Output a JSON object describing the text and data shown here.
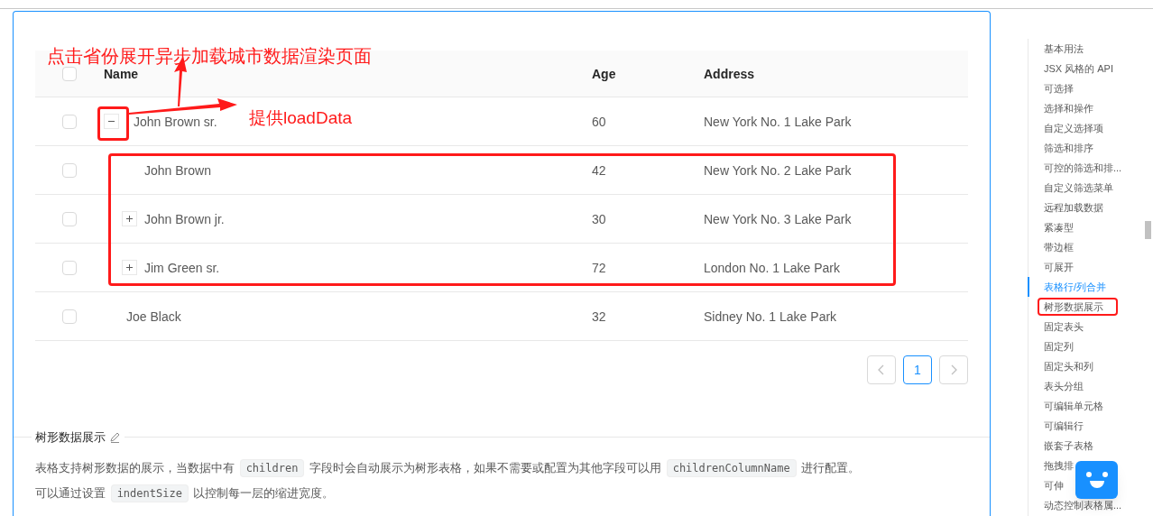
{
  "annotations": {
    "title_note": "点击省份展开异步加载城市数据渲染页面",
    "loaddata_note": "提供loadData"
  },
  "table": {
    "all_checked": false,
    "columns": [
      "Name",
      "Age",
      "Address"
    ],
    "rows": [
      {
        "name": "John Brown sr.",
        "age": "60",
        "address": "New York No. 1 Lake Park",
        "checked": false,
        "expanded": true,
        "children": [
          {
            "name": "John Brown",
            "age": "42",
            "address": "New York No. 2 Lake Park",
            "checked": false
          },
          {
            "name": "John Brown jr.",
            "age": "30",
            "address": "New York No. 3 Lake Park",
            "checked": false,
            "expanded": false
          },
          {
            "name": "Jim Green sr.",
            "age": "72",
            "address": "London No. 1 Lake Park",
            "checked": false,
            "expanded": false
          }
        ]
      },
      {
        "name": "Joe Black",
        "age": "32",
        "address": "Sidney No. 1 Lake Park",
        "checked": false
      }
    ]
  },
  "pagination": {
    "pages": [
      {
        "label": "1",
        "selected": true
      }
    ]
  },
  "section": {
    "title": "树形数据展示",
    "paragraphs": [
      [
        {
          "kind": "text",
          "text": "表格支持树形数据的展示，当数据中有 "
        },
        {
          "kind": "code",
          "text": "children"
        },
        {
          "kind": "text",
          "text": " 字段时会自动展示为树形表格，如果不需要或配置为其他字段可以用 "
        },
        {
          "kind": "code",
          "text": "childrenColumnName"
        },
        {
          "kind": "text",
          "text": " 进行配置。"
        }
      ],
      [
        {
          "kind": "text",
          "text": "可以通过设置 "
        },
        {
          "kind": "code",
          "text": "indentSize"
        },
        {
          "kind": "text",
          "text": " 以控制每一层的缩进宽度。"
        }
      ]
    ]
  },
  "nav": {
    "items": [
      {
        "label": "基本用法",
        "selected": false
      },
      {
        "label": "JSX 风格的 API",
        "selected": false
      },
      {
        "label": "可选择",
        "selected": false
      },
      {
        "label": "选择和操作",
        "selected": false
      },
      {
        "label": "自定义选择项",
        "selected": false
      },
      {
        "label": "筛选和排序",
        "selected": false
      },
      {
        "label": "可控的筛选和排...",
        "selected": false
      },
      {
        "label": "自定义筛选菜单",
        "selected": false
      },
      {
        "label": "远程加载数据",
        "selected": false
      },
      {
        "label": "紧凑型",
        "selected": false
      },
      {
        "label": "带边框",
        "selected": false
      },
      {
        "label": "可展开",
        "selected": false
      },
      {
        "label": "表格行/列合并",
        "selected": true
      },
      {
        "label": "树形数据展示",
        "selected": false
      },
      {
        "label": "固定表头",
        "selected": false
      },
      {
        "label": "固定列",
        "selected": false
      },
      {
        "label": "固定头和列",
        "selected": false
      },
      {
        "label": "表头分组",
        "selected": false
      },
      {
        "label": "可编辑单元格",
        "selected": false
      },
      {
        "label": "可编辑行",
        "selected": false
      },
      {
        "label": "嵌套子表格",
        "selected": false
      },
      {
        "label": "拖拽排",
        "selected": false
      },
      {
        "label": "可伸",
        "selected": false
      },
      {
        "label": "动态控制表格属...",
        "selected": false
      }
    ]
  }
}
